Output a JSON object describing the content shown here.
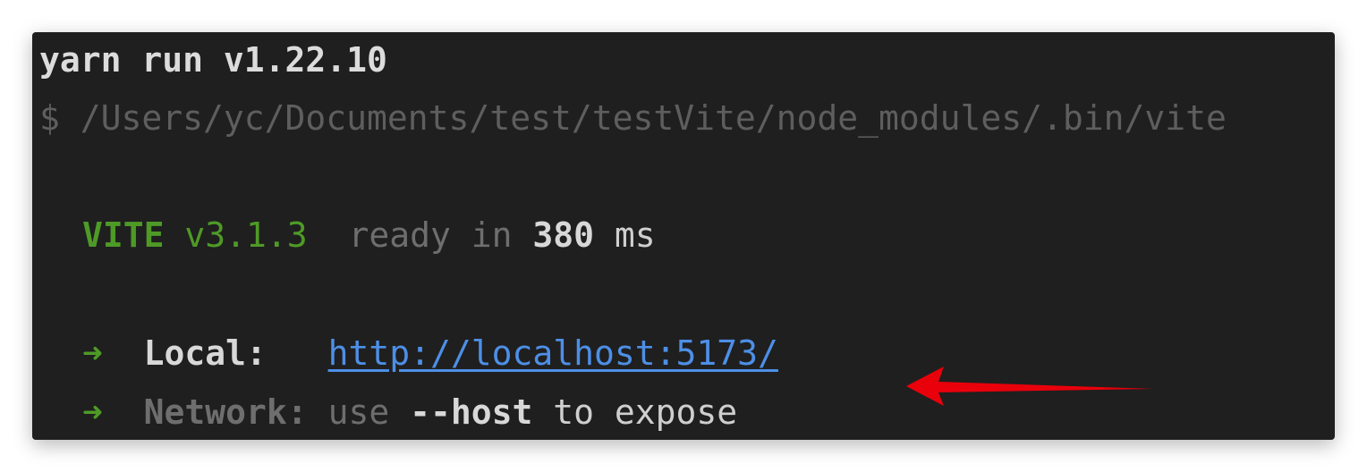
{
  "terminal": {
    "line1": "yarn run v1.22.10",
    "line2": "$ /Users/yc/Documents/test/testVite/node_modules/.bin/vite",
    "vite": {
      "name": "VITE",
      "version": "v3.1.3",
      "ready_text": "ready in",
      "time_value": "380",
      "time_unit": "ms"
    },
    "local": {
      "arrow": "➜",
      "label": "Local:",
      "url": "http://localhost:5173/"
    },
    "network": {
      "arrow": "➜",
      "label": "Network:",
      "text_before": "use",
      "flag": "--host",
      "text_after": "to expose"
    }
  },
  "colors": {
    "background": "#1f1f1f",
    "green": "#4e9a27",
    "link": "#4d8fe6",
    "annotation_arrow": "#e8000b"
  },
  "annotation": {
    "icon": "red-arrow-icon"
  }
}
